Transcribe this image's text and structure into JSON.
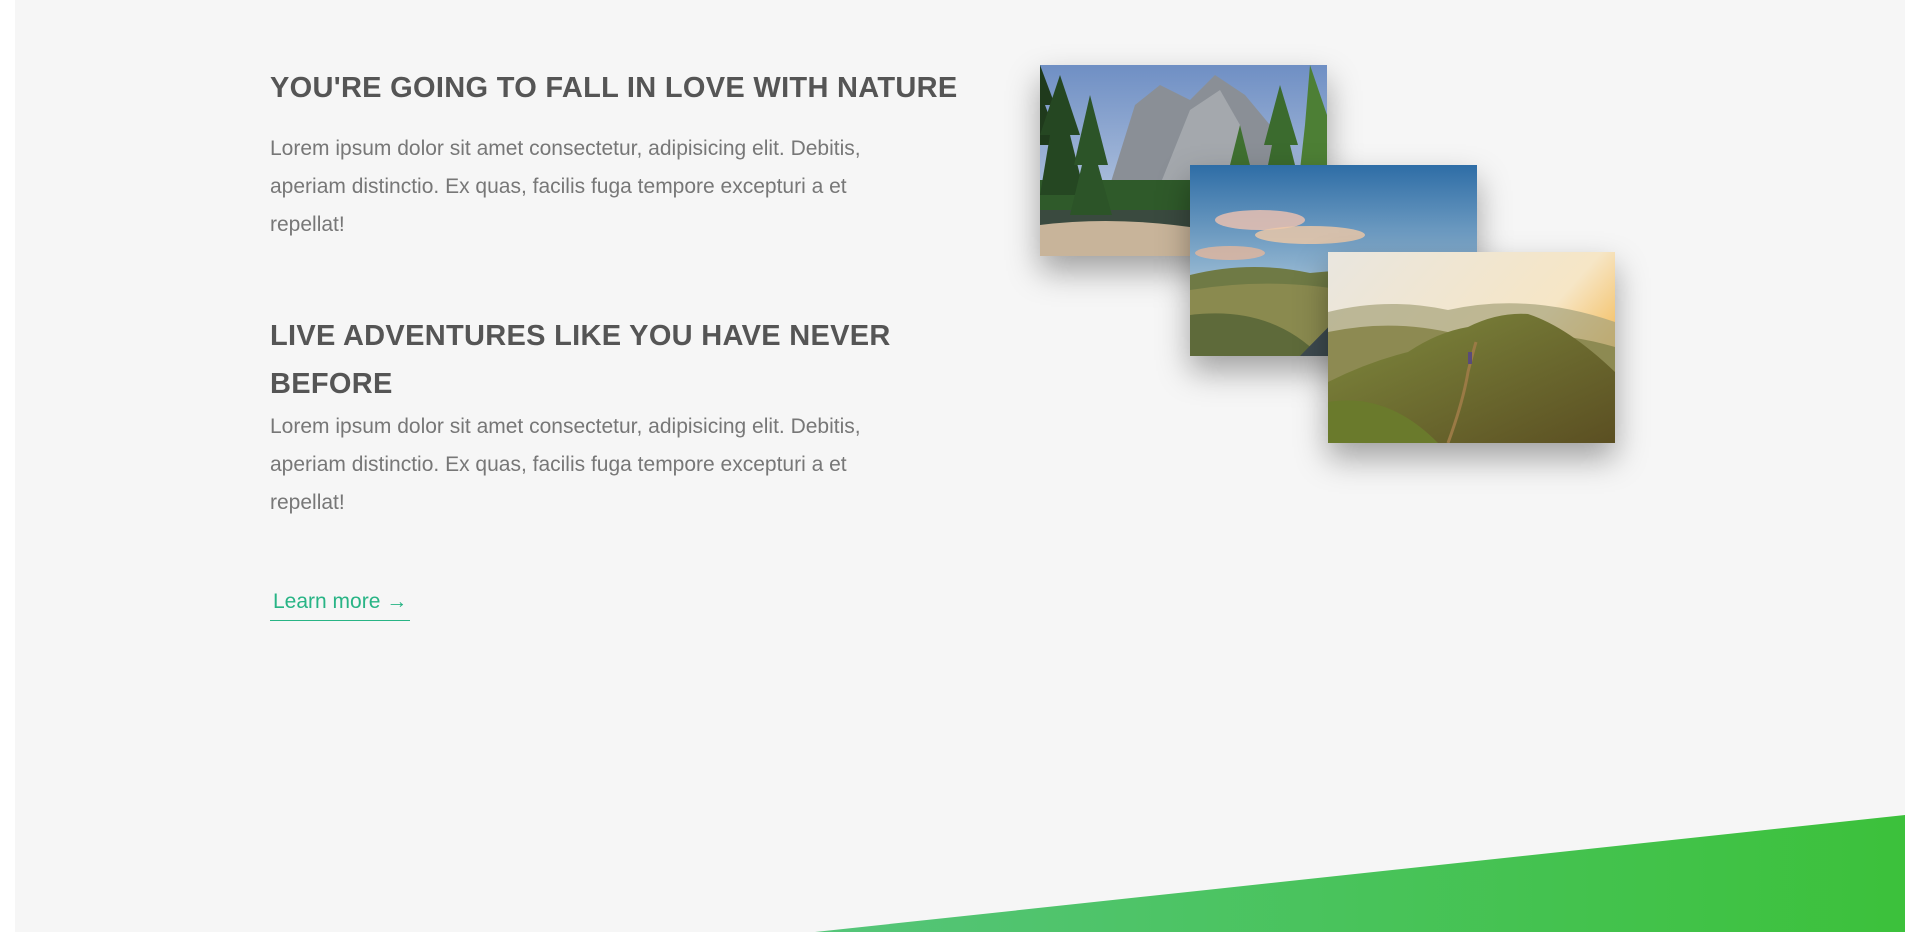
{
  "section": {
    "heading_1": "YOU'RE GOING TO FALL IN LOVE WITH NATURE",
    "paragraph_1": "Lorem ipsum dolor sit amet consectetur, adipisicing elit. Debitis, aperiam distinctio. Ex quas, facilis fuga tempore excepturi a et repellat!",
    "heading_2": "LIVE ADVENTURES LIKE YOU HAVE NEVER BEFORE",
    "paragraph_2": "Lorem ipsum dolor sit amet consectetur, adipisicing elit. Debitis, aperiam distinctio. Ex quas, facilis fuga tempore excepturi a et repellat!",
    "cta_label": "Learn more →"
  },
  "photos": [
    {
      "alt": "Forest and granite cliffs by a river"
    },
    {
      "alt": "Green hills under a sunset sky"
    },
    {
      "alt": "Hiker on a mountain ridge at sunrise"
    }
  ],
  "colors": {
    "background": "#f6f6f6",
    "heading": "#555555",
    "text": "#777777",
    "accent": "#28b485",
    "slope_start": "#55c57a",
    "slope_end": "#3cc13b"
  }
}
